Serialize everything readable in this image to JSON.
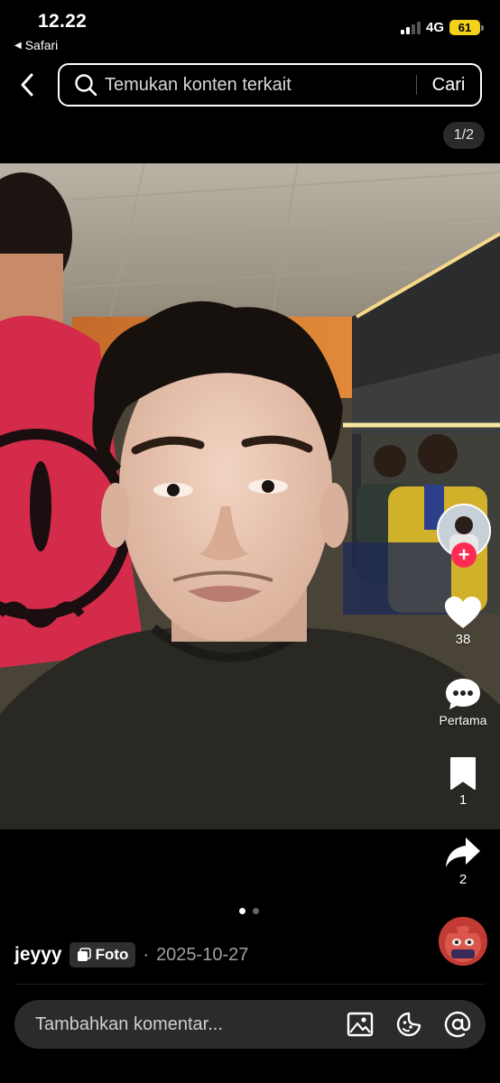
{
  "status_bar": {
    "time": "12.22",
    "back_app": "Safari",
    "network": "4G",
    "battery": "61"
  },
  "search": {
    "placeholder": "Temukan konten terkait",
    "button_label": "Cari"
  },
  "page_counter": "1/2",
  "actions": {
    "likes": "38",
    "comments_label": "Pertama",
    "saves": "1",
    "shares": "2"
  },
  "carousel": {
    "current_index": 1,
    "total": 2
  },
  "post": {
    "username": "jeyyy",
    "type_badge": "Foto",
    "date_separator": "·",
    "date": "2025-10-27"
  },
  "comment": {
    "placeholder": "Tambahkan komentar..."
  },
  "icons": {
    "back": "chevron-left-icon",
    "search": "search-icon",
    "like": "heart-icon",
    "comment": "comment-bubble-icon",
    "save": "bookmark-icon",
    "share": "share-arrow-icon",
    "image": "image-icon",
    "emoji": "emoji-icon",
    "mention": "at-sign-icon"
  },
  "colors": {
    "background": "#000000",
    "accent_red": "#fe2c55",
    "battery_yellow": "#f2d21b"
  }
}
